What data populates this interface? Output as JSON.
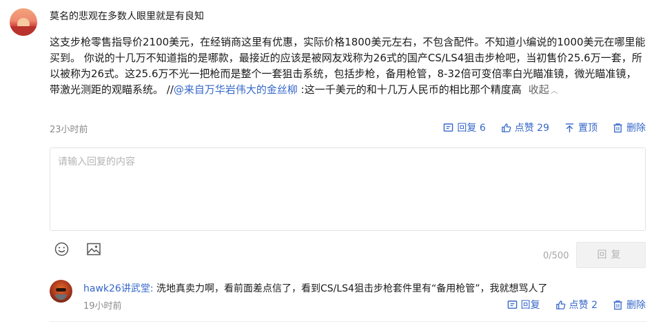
{
  "comment": {
    "username": "莫名的悲观在多数人眼里就是有良知",
    "text_part1": "这支步枪零售指导价2100美元，在经销商这里有优惠，实际价格1800美元左右，不包含配件。不知道小编说的1000美元在哪里能买到。 你说的十几万不知道指的是哪款，最接近的应该是被网友戏称为26式的国产CS/LS4狙击步枪吧，当初售价25.6万一套，所以被称为26式。这25.6万不光一把枪而是整个一套狙击系统，包括步枪，备用枪管，8-32倍可变倍率白光瞄准镜，微光瞄准镜，带激光测距的观瞄系统。 //",
    "mention": "@来自万华岩伟大的金丝柳",
    "text_part2": " :这一千美元的和十几万人民币的相比那个精度高",
    "collapse_label": "收起",
    "time": "23小时前",
    "actions": {
      "reply": "回复 6",
      "like": "点赞 29",
      "pin": "置顶",
      "delete": "删除"
    }
  },
  "reply_editor": {
    "placeholder": "请输入回复的内容",
    "char_count": "0/500",
    "submit_label": "回复"
  },
  "replies": [
    {
      "username": "hawk26讲武堂:",
      "text": " 洗地真卖力啊，看前面差点信了，看到CS/LS4狙击步枪套件里有“备用枪管”，我就想骂人了",
      "time": "19小时前",
      "actions": {
        "reply": "回复",
        "like": "点赞 2",
        "delete": "删除"
      }
    }
  ],
  "colors": {
    "link_blue": "#3567c9",
    "muted_gray": "#8a8a8a"
  },
  "icons": [
    "comment-icon",
    "thumbs-up-icon",
    "pin-top-icon",
    "trash-icon",
    "emoji-icon",
    "image-icon",
    "chevron-up-icon"
  ]
}
